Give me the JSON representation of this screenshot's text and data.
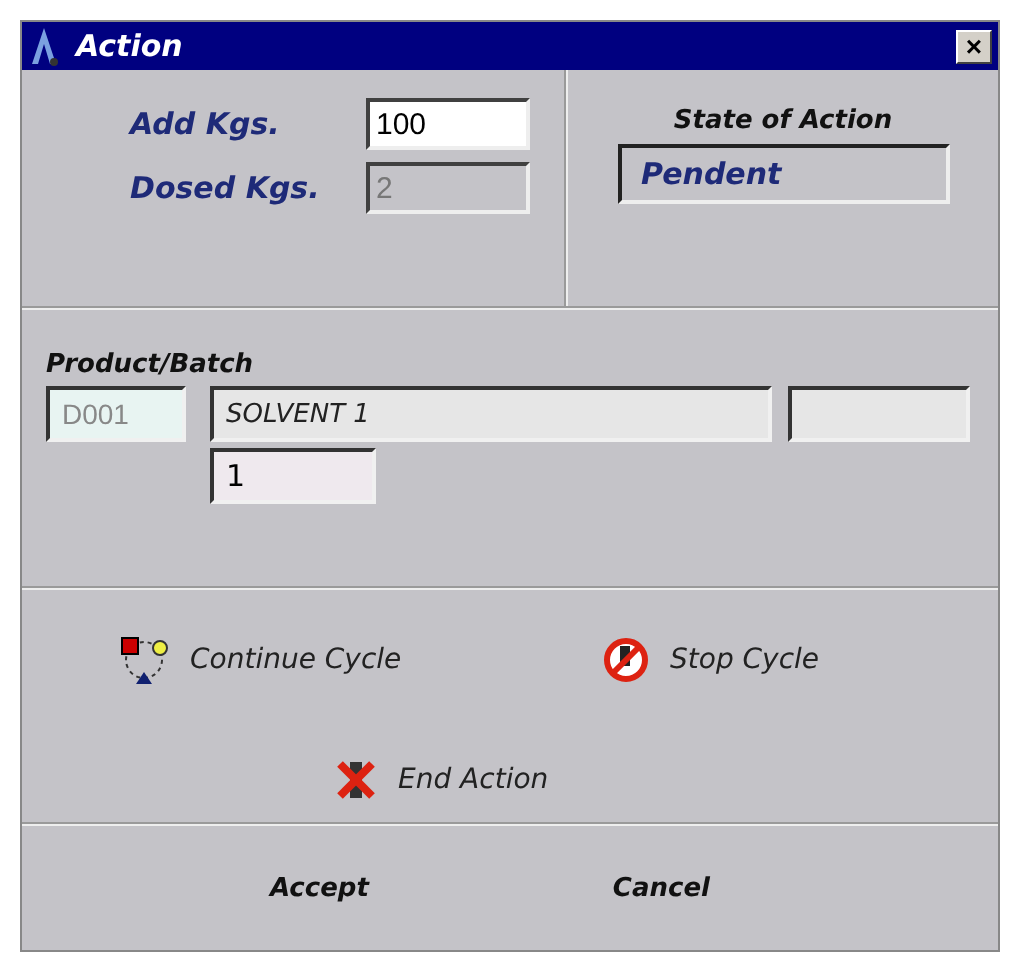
{
  "window": {
    "title": "Action",
    "close": "×"
  },
  "quantities": [
    {
      "label": "Add Kgs.",
      "value": "100",
      "editable": true
    },
    {
      "label": "Dosed Kgs.",
      "value": "2",
      "editable": false
    }
  ],
  "state": {
    "label": "State of Action",
    "value": "Pendent"
  },
  "product": {
    "label": "Product/Batch",
    "code": "D001",
    "name": "SOLVENT 1",
    "batch": "1"
  },
  "actions": [
    {
      "label": "Continue Cycle",
      "kind": "continue"
    },
    {
      "label": "Stop Cycle",
      "kind": "stop"
    },
    {
      "label": "End Action",
      "kind": "end"
    }
  ],
  "buttons": [
    "Accept",
    "Cancel"
  ]
}
